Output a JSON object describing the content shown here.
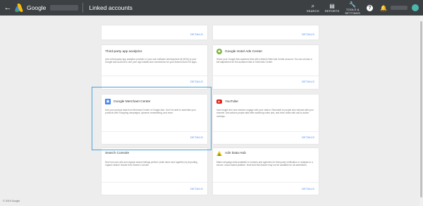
{
  "topbar": {
    "back_glyph": "←",
    "logo_text": "Google",
    "page_title": "Linked accounts",
    "tools": [
      {
        "icon": "search-icon",
        "glyph": "⌕",
        "label": "SEARCH"
      },
      {
        "icon": "reports-icon",
        "glyph": "▤",
        "label": "REPORTS"
      },
      {
        "icon": "wrench-icon",
        "glyph": "🔧",
        "label": "TOOLS &"
      },
      {
        "icon": "wrench-icon",
        "glyph": "",
        "label": "SETTINGS"
      }
    ],
    "help_glyph": "?",
    "bell_glyph": "🔔"
  },
  "cards": {
    "top_left": {
      "details": "DETAILS"
    },
    "top_right": {
      "details": "DETAILS"
    },
    "third_party": {
      "title": "Third-party app analytics",
      "desc": "Link a third-party app analytics provider or your own software development kit (SDK) to your Google Ads account to see your app installs and conversions for your Android and iOS apps.",
      "details": "DETAILS"
    },
    "hotel": {
      "title": "Google Hotel Ads Center",
      "desc": "Share your Google Ads audience lists with a linked Hotel Ads Center account. You can choose a bid adjustment for the audience lists in Hotel Ads Center.",
      "details": "DETAILS"
    },
    "gmc": {
      "title": "Google Merchant Center",
      "desc": "Use your product data from Merchant Center in Google Ads. You'll be able to advertise your products with Shopping campaigns, dynamic remarketing, and more.",
      "details": "DETAILS"
    },
    "youtube": {
      "title": "YouTube",
      "desc": "Gain insight into how viewers engage with your videos. Remarket to people who interact with your channel. And actions people take after watching video ads, and drive clicks with call-to-action overlays.",
      "details": "DETAILS"
    },
    "search_console": {
      "title": "Search Console",
      "desc": "See how your ads and organic search listings perform (both alone and together) by importing organic search results from Search Console.",
      "details": "DETAILS"
    },
    "ads_data_hub": {
      "title": "Ads Data Hub",
      "desc": "Make campaign data available to vendors and agencies for third-party verification or analysis in a secure, cloud-based platform. Note that this feature may not be available for all advertisers.",
      "details": "DETAILS"
    }
  },
  "footer": "© 2019 Google"
}
